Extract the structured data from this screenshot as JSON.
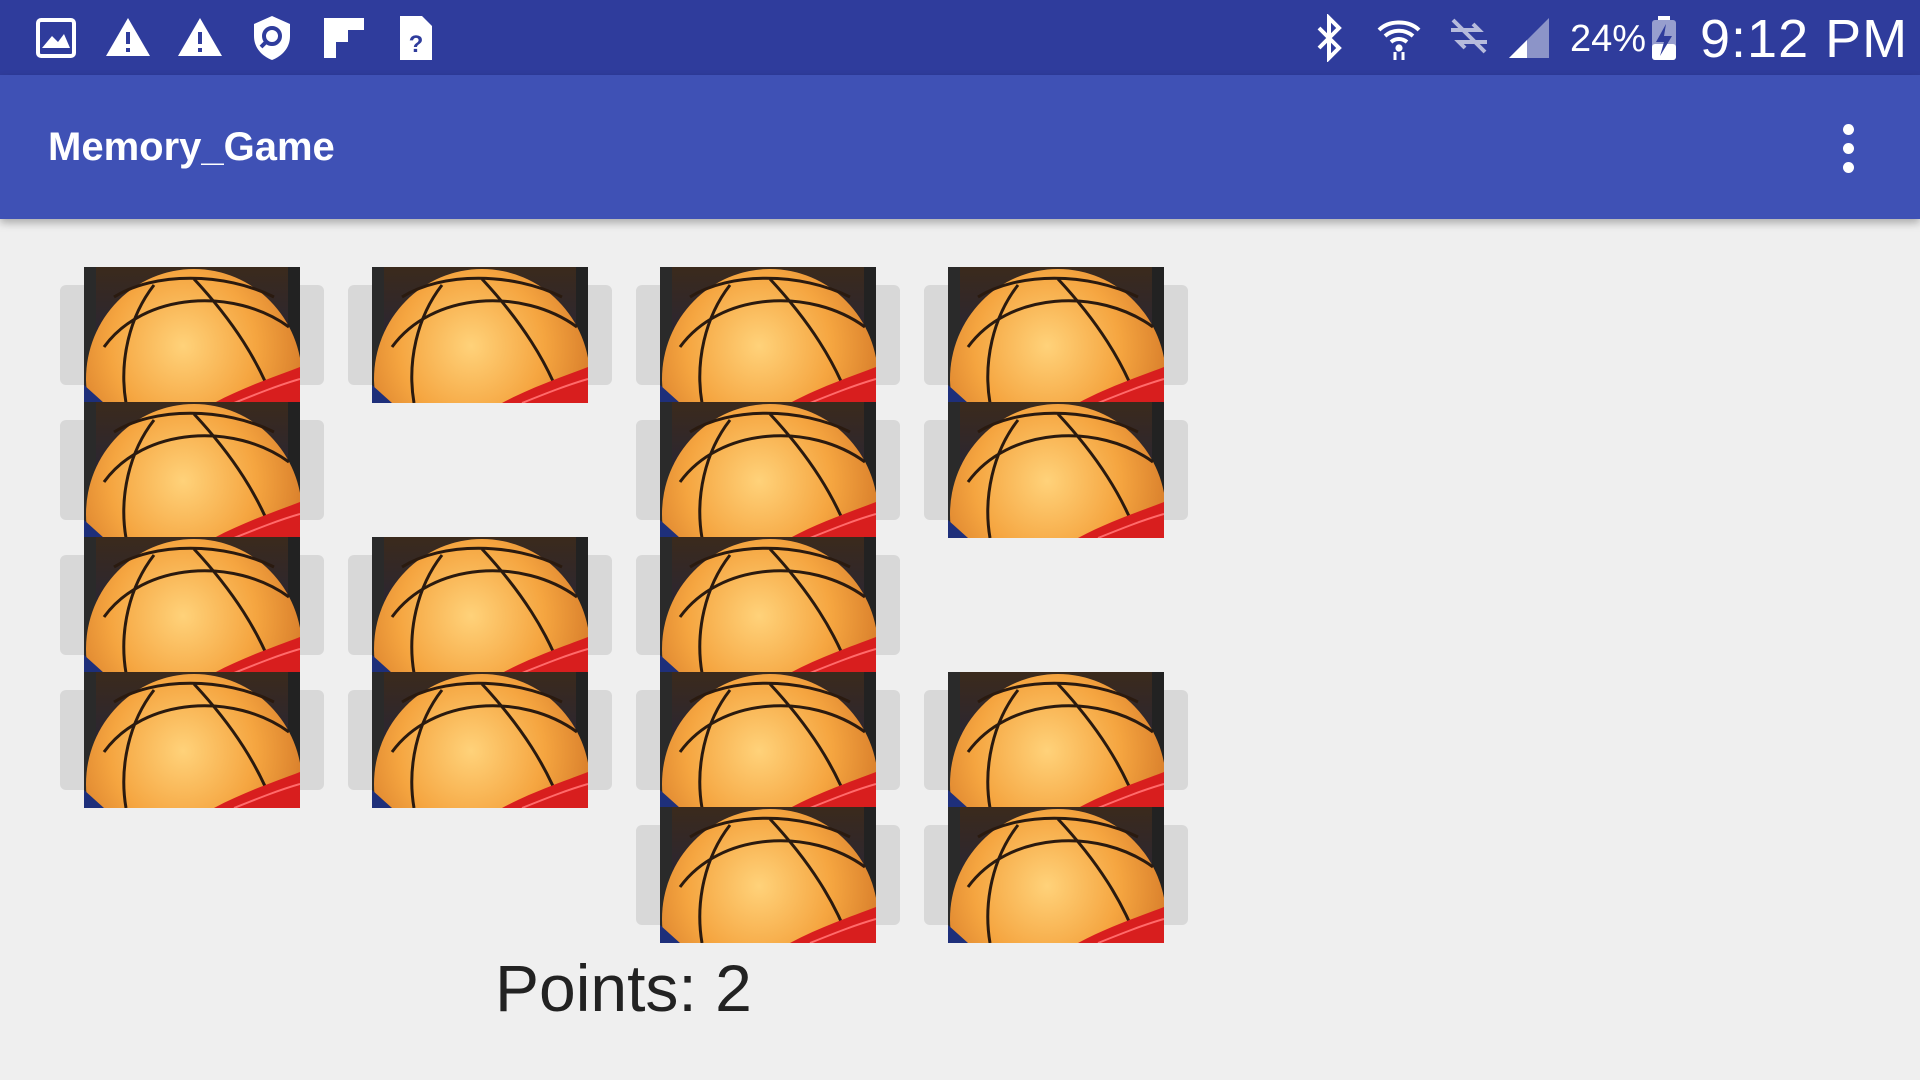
{
  "status_bar": {
    "battery_percent": "24%",
    "time": "9:12 PM",
    "left_icons": [
      "gallery-icon",
      "warning-icon",
      "warning-icon",
      "security-shield-icon",
      "flipboard-icon",
      "unknown-file-icon"
    ],
    "right_icons": [
      "bluetooth-icon",
      "wifi-icon",
      "no-sync-icon",
      "cell-signal-icon",
      "battery-charging-icon"
    ]
  },
  "app_bar": {
    "title": "Memory_Game",
    "overflow_icon": "more-vert-icon",
    "color": "#3f51b5"
  },
  "grid": {
    "rows": 5,
    "cols": 4,
    "cells": [
      {
        "row": 1,
        "col": 1,
        "state": "face-down"
      },
      {
        "row": 1,
        "col": 2,
        "state": "face-down"
      },
      {
        "row": 1,
        "col": 3,
        "state": "face-down"
      },
      {
        "row": 1,
        "col": 4,
        "state": "face-down"
      },
      {
        "row": 2,
        "col": 1,
        "state": "face-down"
      },
      {
        "row": 2,
        "col": 2,
        "state": "matched"
      },
      {
        "row": 2,
        "col": 3,
        "state": "face-down"
      },
      {
        "row": 2,
        "col": 4,
        "state": "face-down"
      },
      {
        "row": 3,
        "col": 1,
        "state": "face-down"
      },
      {
        "row": 3,
        "col": 2,
        "state": "face-down"
      },
      {
        "row": 3,
        "col": 3,
        "state": "face-down"
      },
      {
        "row": 3,
        "col": 4,
        "state": "matched"
      },
      {
        "row": 4,
        "col": 1,
        "state": "face-down"
      },
      {
        "row": 4,
        "col": 2,
        "state": "face-down"
      },
      {
        "row": 4,
        "col": 3,
        "state": "face-down"
      },
      {
        "row": 4,
        "col": 4,
        "state": "face-down"
      },
      {
        "row": 5,
        "col": 1,
        "state": "matched"
      },
      {
        "row": 5,
        "col": 2,
        "state": "matched"
      },
      {
        "row": 5,
        "col": 3,
        "state": "face-down"
      },
      {
        "row": 5,
        "col": 4,
        "state": "face-down"
      }
    ],
    "card_image": "basketball-card-back"
  },
  "score": {
    "text": "Points: 2"
  }
}
